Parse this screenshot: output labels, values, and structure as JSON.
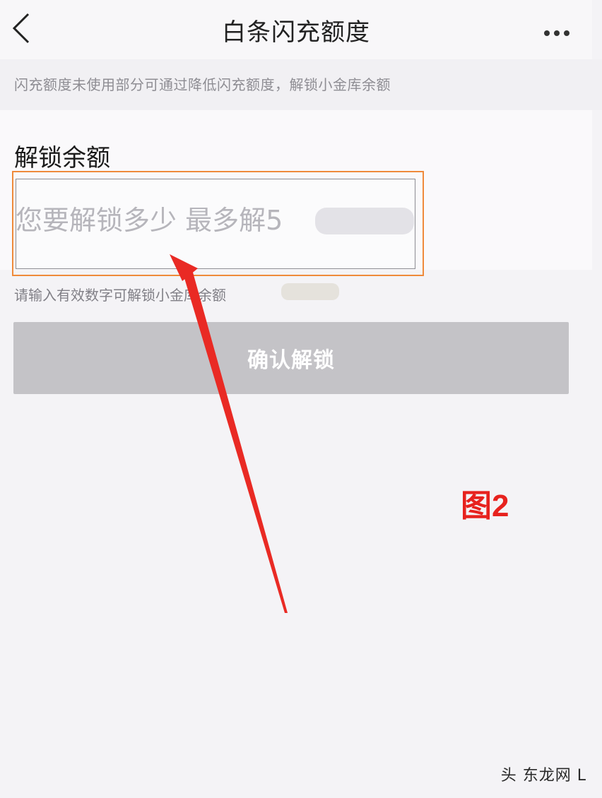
{
  "nav": {
    "title": "白条闪充额度",
    "back_icon": "chevron-left-icon",
    "more_icon": "more-horizontal-icon"
  },
  "notice": {
    "text": "闪充额度未使用部分可通过降低闪充额度，解锁小金库余额"
  },
  "unlock": {
    "title": "解锁余额",
    "input_placeholder": "您要解锁多少 最多解5",
    "hint": "请输入有效数字可解锁小金库余额"
  },
  "button": {
    "confirm_label": "确认解锁"
  },
  "annotation": {
    "figure_label": "图2",
    "arrow_color": "#e92a24",
    "highlight_color": "#ef8a3a"
  },
  "watermark": {
    "text": "头 东龙网 L"
  }
}
